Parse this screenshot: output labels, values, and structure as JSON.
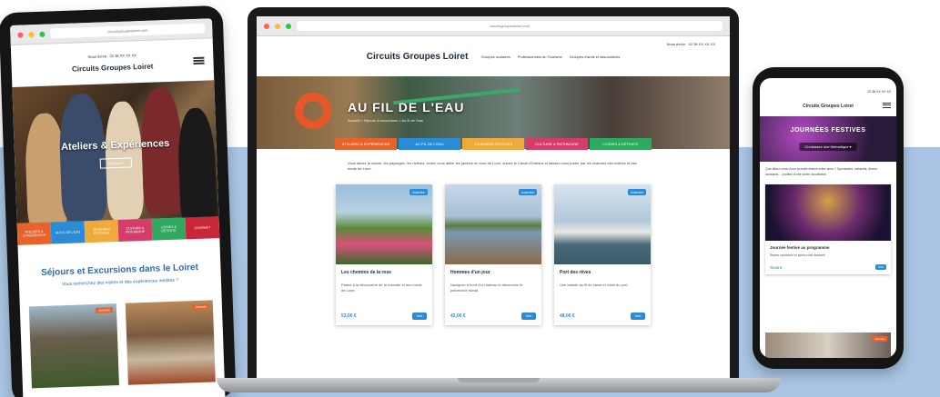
{
  "colors": {
    "band": "#a9c5e3",
    "accent_blue": "#2b8bd6",
    "tab_colors": [
      "#e8622c",
      "#2b8bd6",
      "#f0a93b",
      "#d43c6a",
      "#2fa860",
      "#c9263a"
    ]
  },
  "tablet": {
    "url": "circuitsgroupesloiret.com",
    "topline": "Nous écrire   ·   02 38 XX XX XX",
    "logo": "Circuits Groupes Loiret",
    "hero_title": "Ateliers & Expériences",
    "hero_button": "Découvrir",
    "tabs": [
      "ATELIERS & EXPÉRIENCES",
      "AU FIL DE L'EAU",
      "JOURNÉES FESTIVES",
      "CULTURE & PATRIMOINE",
      "LOISIRS & DÉTENTE",
      "GOURMET"
    ],
    "heading": "Séjours et Excursions dans le Loiret",
    "subheading": "Vous recherchez des visites et des expériences inédites ?",
    "card_tag": "Journée"
  },
  "laptop": {
    "url": "circuitsgroupesloiret.com",
    "topline": "Nous écrire   ·   02 38 XX XX XX",
    "logo": "Circuits Groupes Loiret",
    "nav": [
      "Groupes scolaires",
      "Professionnels du Tourisme",
      "Groupes d'amis et associations"
    ],
    "hero_title": "AU FIL DE L'EAU",
    "breadcrumb": "Accueil  >  Séjours & excursions  >  Au fil de l'eau",
    "tabs": [
      "ATELIERS & EXPÉRIENCES",
      "AU FIL DE L'EAU",
      "JOURNÉES FESTIVES",
      "CULTURE & PATRIMOINE",
      "LOISIRS & DÉTENTE"
    ],
    "intro": "Vous aimez la nature, les paysages, les rivières, venez vous délier les jambes en bord de Loire, suivez le Canal d'Orléans et laissez-vous porter par les charmes des rivières et des bords de Loire.",
    "cards": [
      {
        "title": "Les chemins de la rose",
        "desc": "Partez à la découverte de la roseraie et des bords de Loire.",
        "price": "53,00 €",
        "tag": "Journée",
        "button": "Voir"
      },
      {
        "title": "Hommes d'un jour",
        "desc": "Naviguez à bord d'un bateau et découvrez le patrimoine fluvial.",
        "price": "42,00 €",
        "tag": "Journée",
        "button": "Voir"
      },
      {
        "title": "Port des rêves",
        "desc": "Une balade au fil du canal et visite du port.",
        "price": "48,00 €",
        "tag": "Journée",
        "button": "Voir"
      }
    ]
  },
  "phone": {
    "topline": "02 38 XX XX XX",
    "logo": "Circuits Groupes Loiret",
    "hero_title": "JOURNÉES FESTIVES",
    "select": "Choisissez une thématique ▾",
    "intro": "Que diriez-vous d'une journée festive entre amis ? Spectacles, cabarets, dîners dansants… profitez d'une sortie inoubliable.",
    "card_title": "Journée festive au programme",
    "card_desc": "Repas spectacle et après-midi dansant.",
    "card_price": "75,00 €",
    "card_button": "Voir",
    "bottom_tag": "Journée"
  }
}
